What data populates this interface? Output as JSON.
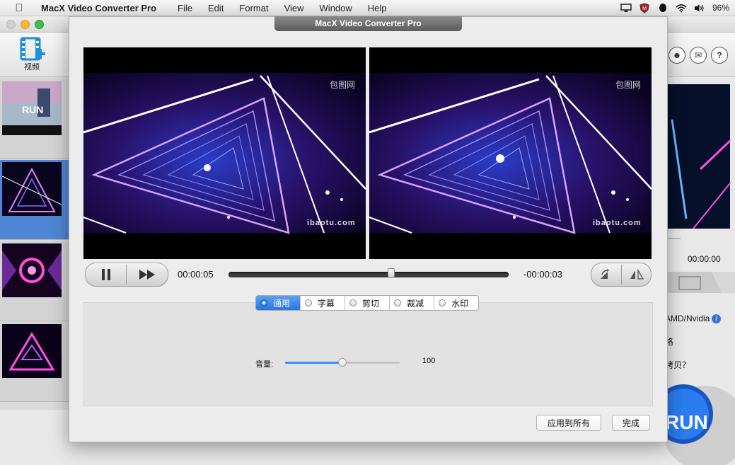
{
  "menubar": {
    "app_name": "MacX Video Converter Pro",
    "menus": [
      "File",
      "Edit",
      "Format",
      "View",
      "Window",
      "Help"
    ],
    "battery": "96%"
  },
  "toolbar": {
    "add_video_label": "视频"
  },
  "right_panel": {
    "time": "00:00:00",
    "hw_label": "AMD/Nvidia",
    "label2": "格",
    "label3": "拷贝？",
    "run_label": "RUN"
  },
  "thumbnails": [
    {
      "label": "RUN"
    },
    {
      "label": ""
    },
    {
      "label": ""
    },
    {
      "label": ""
    }
  ],
  "dialog": {
    "title": "MacX Video Converter Pro",
    "watermark_top": "包图网",
    "watermark_bottom": "ibaotu.com",
    "elapsed": "00:00:05",
    "remaining": "-00:00:03",
    "progress_fraction": 0.58,
    "tabs": [
      "通用",
      "字幕",
      "剪切",
      "裁减",
      "水印"
    ],
    "active_tab": 0,
    "volume_label": "音量:",
    "volume_value": "100",
    "volume_fraction": 0.5,
    "apply_all_label": "应用到所有",
    "done_label": "完成"
  },
  "colors": {
    "accent": "#2d74de",
    "selected_row": "#4f86d6"
  }
}
